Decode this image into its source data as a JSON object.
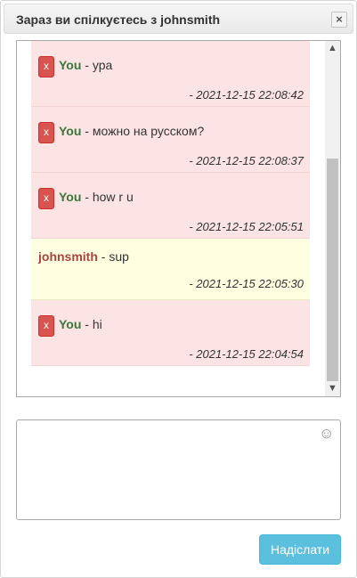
{
  "header": {
    "title": "Зараз ви спілкуєтесь з johnsmith",
    "close_label": "×",
    "close_icon": "close-icon"
  },
  "messages": [
    {
      "sender": "You",
      "text": " - ура",
      "timestamp": "- 2021-12-15 22:08:42",
      "mine": true,
      "delete_label": "x"
    },
    {
      "sender": "You",
      "text": " - можно на русском?",
      "timestamp": "- 2021-12-15 22:08:37",
      "mine": true,
      "delete_label": "x"
    },
    {
      "sender": "You",
      "text": " - how r u",
      "timestamp": "- 2021-12-15 22:05:51",
      "mine": true,
      "delete_label": "x"
    },
    {
      "sender": "johnsmith",
      "text": " - sup",
      "timestamp": "- 2021-12-15 22:05:30",
      "mine": false
    },
    {
      "sender": "You",
      "text": " - hi",
      "timestamp": "- 2021-12-15 22:04:54",
      "mine": true,
      "delete_label": "x"
    }
  ],
  "scrollbar": {
    "up_glyph": "▲",
    "down_glyph": "▼"
  },
  "compose": {
    "value": "",
    "emoji_glyph": "☺",
    "emoji_icon": "smiley-icon"
  },
  "send_button": {
    "label": "Надіслати"
  },
  "colors": {
    "own_message_bg": "#fde4e4",
    "other_message_bg": "#fefee0",
    "own_sender": "#3c763d",
    "other_sender": "#a94442",
    "delete_button": "#d9534f",
    "send_button": "#5bc0de"
  }
}
